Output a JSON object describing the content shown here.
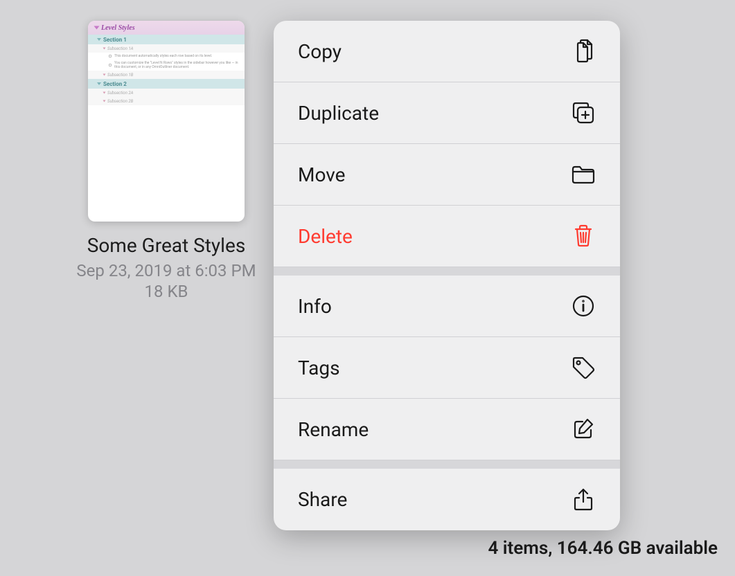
{
  "file": {
    "name": "Some Great Styles",
    "date": "Sep 23, 2019 at 6:03 PM",
    "size": "18 KB"
  },
  "thumbnail": {
    "title": "Level Styles",
    "section1": "Section 1",
    "sub1a": "Subsection 1A",
    "body1": "This document automatically styles each row based on its level.",
    "body2": "You can customize the \"Level N Rows\" styles in the sidebar however you like — in this document, or in any OmniOutliner document.",
    "sub1b": "Subsection 1B",
    "section2": "Section 2",
    "sub2a": "Subsection 2A",
    "sub2b": "Subsection 2B"
  },
  "menu": {
    "copy": "Copy",
    "duplicate": "Duplicate",
    "move": "Move",
    "delete": "Delete",
    "info": "Info",
    "tags": "Tags",
    "rename": "Rename",
    "share": "Share"
  },
  "status": "4 items, 164.46 GB available"
}
